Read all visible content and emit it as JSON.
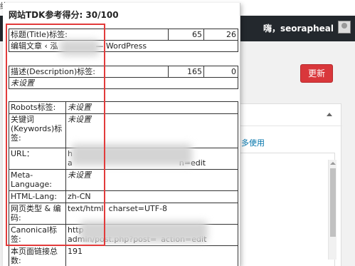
{
  "adminbar": {
    "cut_text": "终",
    "user_greeting": "嗨，seorapheal"
  },
  "background": {
    "update_label": "更新",
    "more_link": "多使用"
  },
  "popup": {
    "title": "网站TDK参考得分: 30/100",
    "title_row": {
      "label": "标题(Title)标签:",
      "len": "65",
      "score": "26",
      "value": "编辑文章 ‹ 泓",
      "value_suffix": "— WordPress"
    },
    "desc_row": {
      "label": "描述(Description)标签:",
      "len": "165",
      "score": "0",
      "value": "未设置"
    },
    "rows": [
      {
        "label": "Robots标签:",
        "value": "未设置",
        "italic": true
      },
      {
        "label": "关键词(Keywords)标签:",
        "value": "未设置",
        "italic": true
      },
      {
        "label": "URL：",
        "value": "h",
        "value2": "a",
        "value_tail": "n=edit",
        "italic": false
      },
      {
        "label": "Meta-Language:",
        "value": "未设置",
        "italic": true
      },
      {
        "label": "HTML-Lang:",
        "value": "zh-CN",
        "italic": false
      },
      {
        "label": "网页类型 & 编码:",
        "value": "text/html; charset=UTF-8",
        "italic": false
      },
      {
        "label": "Canonical标签:",
        "value": "http",
        "value2": "admin/post.php?post=",
        "value_tail": "action=edit",
        "italic": false
      },
      {
        "label": "本页面链接总数:",
        "value": "191",
        "italic": false
      }
    ]
  }
}
